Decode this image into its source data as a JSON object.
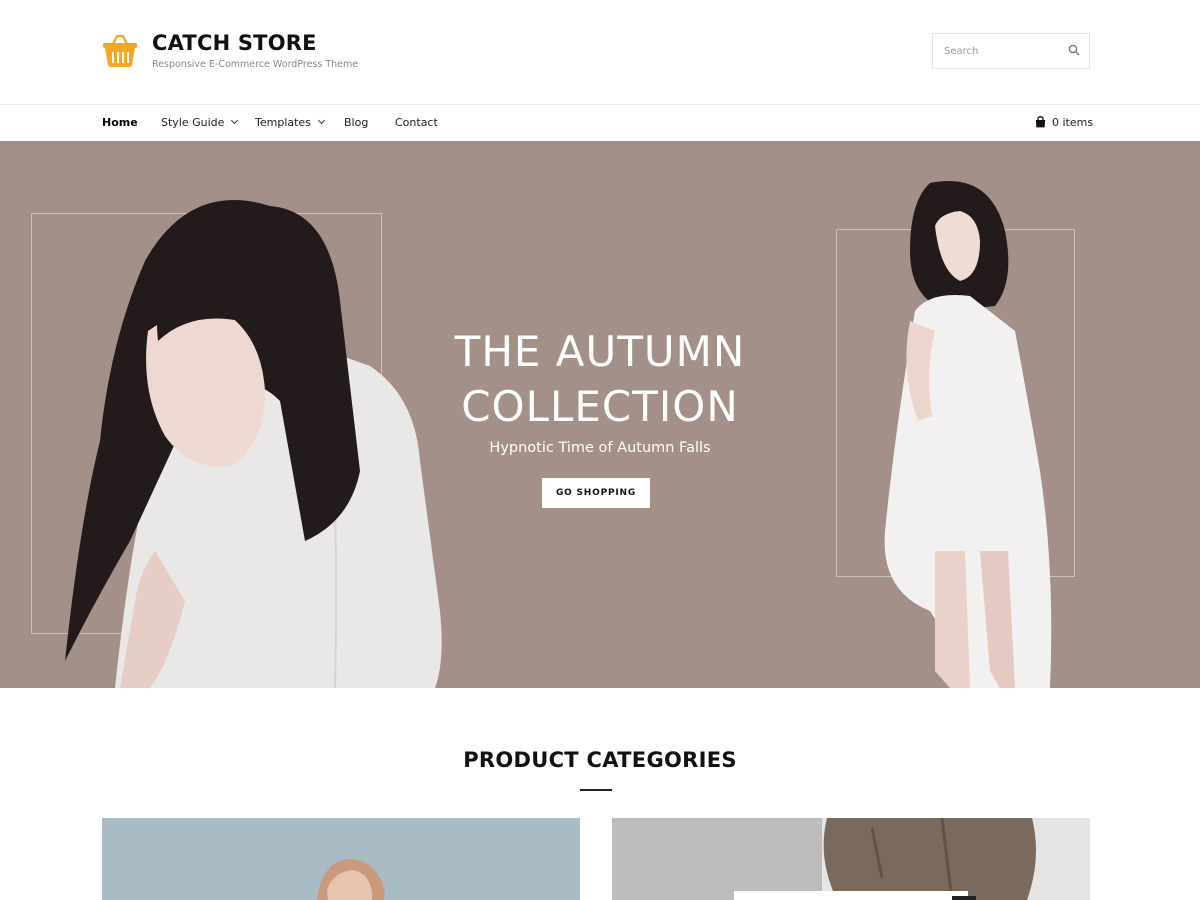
{
  "site": {
    "title": "CATCH STORE",
    "tagline": "Responsive E-Commerce WordPress Theme",
    "logo_icon": "shopping-basket-icon",
    "brand_color": "#f5a623"
  },
  "search": {
    "placeholder": "Search",
    "icon": "search-icon"
  },
  "nav": {
    "items": [
      {
        "label": "Home",
        "active": true
      },
      {
        "label": "Style Guide",
        "has_dropdown": true
      },
      {
        "label": "Templates",
        "has_dropdown": true
      },
      {
        "label": "Blog"
      },
      {
        "label": "Contact"
      }
    ],
    "cart_label": "0 items",
    "cart_icon": "shopping-bag-icon"
  },
  "hero": {
    "title_line1": "THE AUTUMN",
    "title_line2": "COLLECTION",
    "subtitle": "Hypnotic Time of Autumn Falls",
    "button_label": "GO SHOPPING",
    "background_color": "#a39088"
  },
  "categories": {
    "title": "PRODUCT CATEGORIES"
  }
}
